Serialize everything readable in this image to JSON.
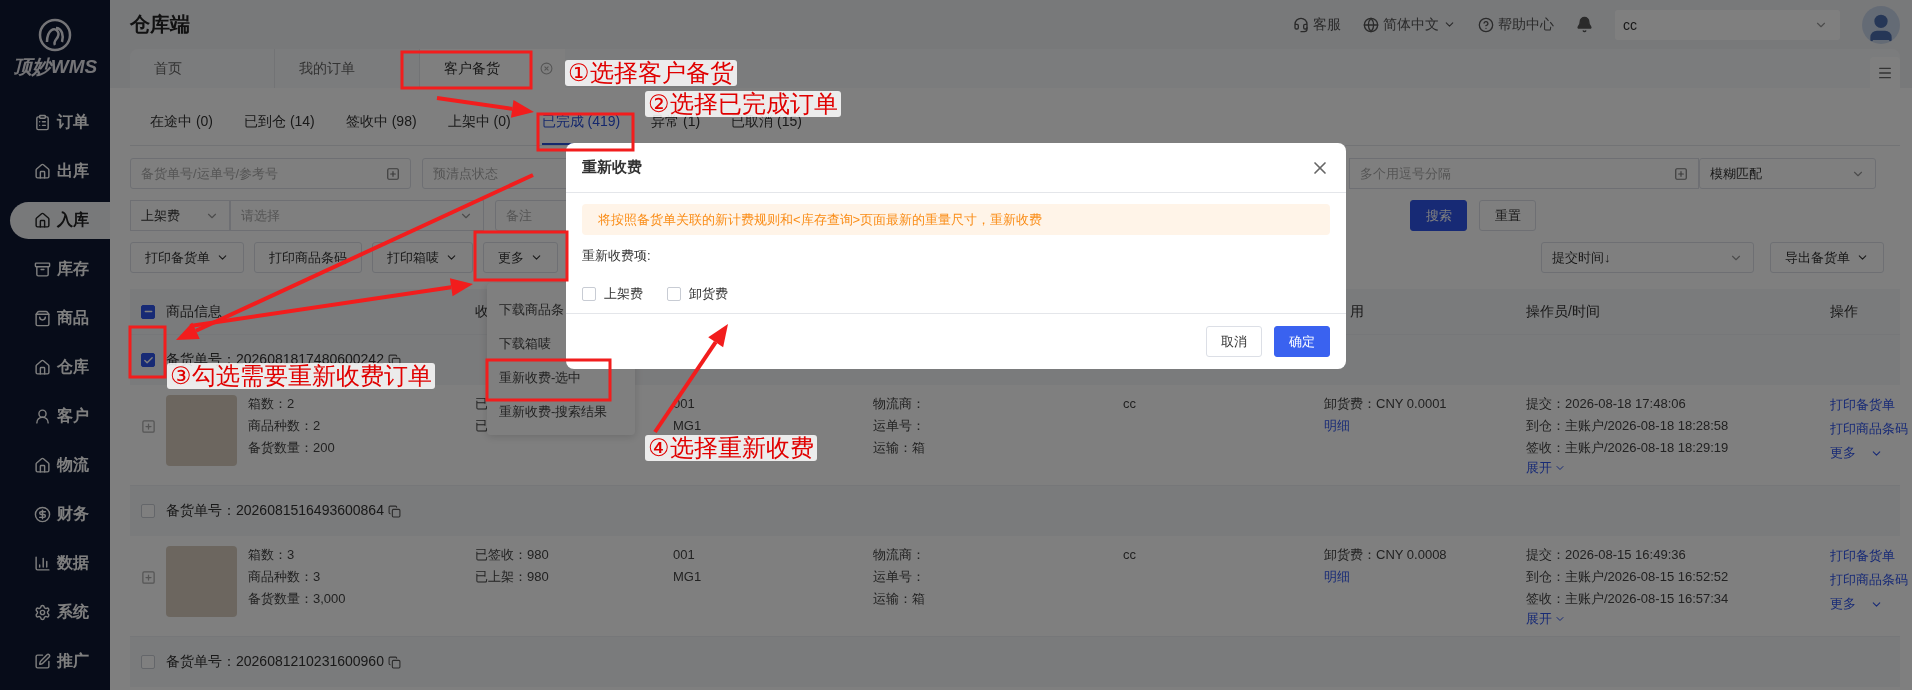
{
  "brand": {
    "logo_text": "顶妙WMS",
    "title": "仓库端"
  },
  "sidebar": {
    "items": [
      {
        "label": "订单",
        "selected": false
      },
      {
        "label": "出库",
        "selected": false
      },
      {
        "label": "入库",
        "selected": true
      },
      {
        "label": "库存",
        "selected": false
      },
      {
        "label": "商品",
        "selected": false
      },
      {
        "label": "仓库",
        "selected": false
      },
      {
        "label": "客户",
        "selected": false
      },
      {
        "label": "物流",
        "selected": false
      },
      {
        "label": "财务",
        "selected": false
      },
      {
        "label": "数据",
        "selected": false
      },
      {
        "label": "系统",
        "selected": false
      },
      {
        "label": "推广",
        "selected": false
      }
    ]
  },
  "header": {
    "service": "客服",
    "language": "简体中文",
    "help": "帮助中心",
    "account": "cc"
  },
  "page_tabs": [
    {
      "label": "首页",
      "selected": false,
      "closable": false
    },
    {
      "label": "我的订单",
      "selected": false,
      "closable": false
    },
    {
      "label": "客户备货",
      "selected": true,
      "closable": true
    }
  ],
  "status_tabs": [
    {
      "label": "在途中 (0)",
      "selected": false
    },
    {
      "label": "已到仓 (14)",
      "selected": false
    },
    {
      "label": "签收中 (98)",
      "selected": false
    },
    {
      "label": "上架中 (0)",
      "selected": false
    },
    {
      "label": "已完成 (419)",
      "selected": true
    },
    {
      "label": "异常 (1)",
      "selected": false
    },
    {
      "label": "已取消 (15)",
      "selected": false
    }
  ],
  "filters": {
    "order_search": {
      "placeholder": "备货单号/运单号/参考号"
    },
    "precount": {
      "placeholder": "预清点状态"
    },
    "multi": {
      "placeholder": "多个用逗号分隔"
    },
    "match": {
      "value": "模糊匹配"
    },
    "fee_type": {
      "value": "上架费"
    },
    "fee_value": {
      "placeholder": "请选择"
    },
    "remark": {
      "placeholder": "备注"
    },
    "search": "搜索",
    "reset": "重置"
  },
  "toolbar": {
    "buttons": [
      {
        "label": "打印备货单",
        "dropdown": true
      },
      {
        "label": "打印商品条码",
        "dropdown": false
      },
      {
        "label": "打印箱唛",
        "dropdown": true
      },
      {
        "label": "更多",
        "dropdown": true
      }
    ],
    "sort": {
      "value": "提交时间↓"
    },
    "export": {
      "label": "导出备货单",
      "dropdown": true
    }
  },
  "more_menu": {
    "items": [
      {
        "label": "下载商品条"
      },
      {
        "label": "下载箱唛"
      },
      {
        "label": "重新收费-选中"
      },
      {
        "label": "重新收费-搜索结果"
      }
    ]
  },
  "table": {
    "indeterminate": true,
    "columns": [
      {
        "label": "商品信息"
      },
      {
        "label": "收"
      },
      {
        "label": "用"
      },
      {
        "label": "操作员/时间"
      },
      {
        "label": "操作"
      }
    ],
    "orders": [
      {
        "number_label": "备货单号：",
        "number": "2026081817480600242",
        "checked": true,
        "counts": [
          "箱数：2",
          "商品种数：2",
          "备货数量：200"
        ],
        "received": [
          "已",
          "已"
        ],
        "codes": [
          "001",
          "MG1"
        ],
        "logistics": [
          "物流商：",
          "运单号：",
          "运输：箱"
        ],
        "customer": "cc",
        "fee": "卸货费：CNY 0.0001",
        "fee_link": "明细",
        "times": [
          "提交：2026-08-18 17:48:06",
          "到仓：主账户/2026-08-18 18:28:58",
          "签收：主账户/2026-08-18 18:29:19"
        ],
        "expand_link": "展开",
        "actions": [
          "打印备货单",
          "打印商品条码",
          "更多"
        ]
      },
      {
        "number_label": "备货单号：",
        "number": "2026081516493600864",
        "checked": false,
        "counts": [
          "箱数：3",
          "商品种数：3",
          "备货数量：3,000"
        ],
        "received": [
          "已签收：980",
          "已上架：980"
        ],
        "codes": [
          "001",
          "MG1"
        ],
        "logistics": [
          "物流商：",
          "运单号：",
          "运输：箱"
        ],
        "customer": "cc",
        "fee": "卸货费：CNY 0.0008",
        "fee_link": "明细",
        "times": [
          "提交：2026-08-15 16:49:36",
          "到仓：主账户/2026-08-15 16:52:52",
          "签收：主账户/2026-08-15 16:57:34"
        ],
        "expand_link": "展开",
        "actions": [
          "打印备货单",
          "打印商品条码",
          "更多"
        ]
      },
      {
        "number_label": "备货单号：",
        "number": "2026081210231600960",
        "checked": false
      }
    ]
  },
  "modal": {
    "title": "重新收费",
    "notice": "将按照备货单关联的新计费规则和<库存查询>页面最新的重量尺寸，重新收费",
    "options_label": "重新收费项:",
    "options": [
      {
        "label": "上架费",
        "checked": false
      },
      {
        "label": "卸货费",
        "checked": false
      }
    ],
    "cancel": "取消",
    "confirm": "确定"
  },
  "annotations": [
    {
      "text": "①选择客户备货"
    },
    {
      "text": "②选择已完成订单"
    },
    {
      "text": "③勾选需要重新收费订单"
    },
    {
      "text": "④选择重新收费"
    }
  ]
}
